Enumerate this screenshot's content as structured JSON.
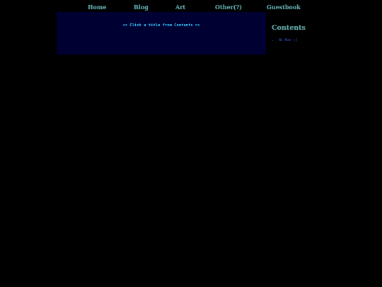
{
  "nav": {
    "items": [
      {
        "label": "Home"
      },
      {
        "label": "Blog"
      },
      {
        "label": "Art"
      },
      {
        "label": "Other(?)"
      },
      {
        "label": "Guestbook"
      }
    ]
  },
  "main": {
    "hint": "<< Click a title from Contents >>"
  },
  "sidebar": {
    "title": "Contents",
    "items": [
      {
        "label": "Ni Hao ;)"
      }
    ]
  },
  "colors": {
    "background": "#000000",
    "panel": "#000033",
    "nav_link": "#5f9ea0",
    "hint_text": "#33ccff",
    "list_link": "#3355cc"
  }
}
